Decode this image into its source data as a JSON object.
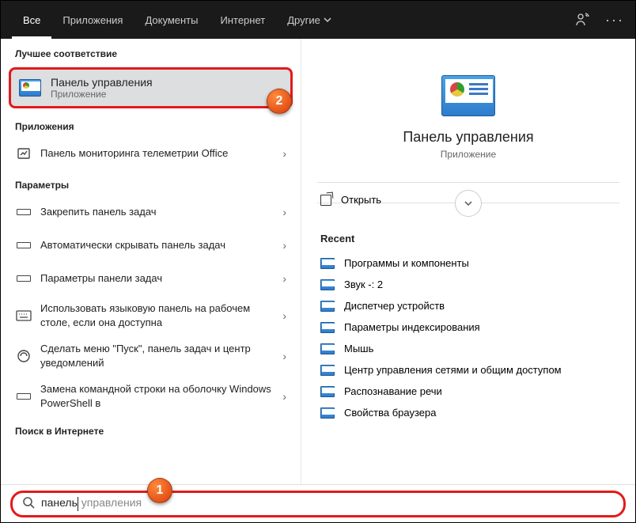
{
  "topbar": {
    "tabs": [
      "Все",
      "Приложения",
      "Документы",
      "Интернет",
      "Другие"
    ],
    "active_index": 0
  },
  "left": {
    "best_match_header": "Лучшее соответствие",
    "best_match": {
      "title": "Панель управления",
      "subtitle": "Приложение"
    },
    "apps_header": "Приложения",
    "apps": [
      {
        "text": "Панель мониторинга телеметрии Office"
      }
    ],
    "settings_header": "Параметры",
    "settings": [
      {
        "text": "Закрепить панель задач"
      },
      {
        "text": "Автоматически скрывать панель задач"
      },
      {
        "text": "Параметры панели задач"
      },
      {
        "text": "Использовать языковую панель на рабочем столе, если она доступна"
      },
      {
        "text": "Сделать меню \"Пуск\", панель задач и центр уведомлений"
      },
      {
        "text": "Замена командной строки на оболочку Windows PowerShell в"
      }
    ],
    "web_header": "Поиск в Интернете"
  },
  "right": {
    "title": "Панель управления",
    "subtitle": "Приложение",
    "open_label": "Открыть",
    "recent_header": "Recent",
    "recent": [
      "Программы и компоненты",
      "Звук -: 2",
      "Диспетчер устройств",
      "Параметры индексирования",
      "Мышь",
      "Центр управления сетями и общим доступом",
      "Распознавание речи",
      "Свойства браузера"
    ]
  },
  "search": {
    "typed": "панель",
    "hint": " управления"
  },
  "markers": {
    "one": "1",
    "two": "2"
  }
}
